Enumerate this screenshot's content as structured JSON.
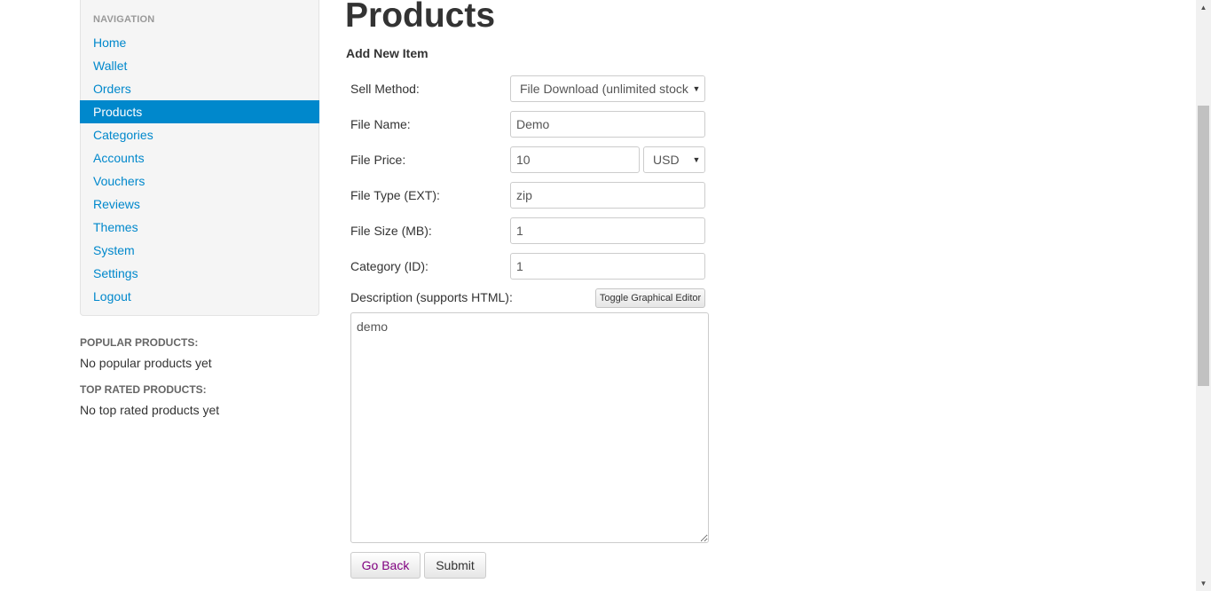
{
  "sidebar": {
    "nav_header": "NAVIGATION",
    "items": [
      {
        "label": "Home"
      },
      {
        "label": "Wallet"
      },
      {
        "label": "Orders"
      },
      {
        "label": "Products"
      },
      {
        "label": "Categories"
      },
      {
        "label": "Accounts"
      },
      {
        "label": "Vouchers"
      },
      {
        "label": "Reviews"
      },
      {
        "label": "Themes"
      },
      {
        "label": "System"
      },
      {
        "label": "Settings"
      },
      {
        "label": "Logout"
      }
    ],
    "active_item": "Products",
    "popular_heading": "POPULAR PRODUCTS:",
    "popular_text": "No popular products yet",
    "top_rated_heading": "TOP RATED PRODUCTS:",
    "top_rated_text": "No top rated products yet"
  },
  "main": {
    "title": "Products",
    "subheading": "Add New Item",
    "form": {
      "sell_method_label": "Sell Method:",
      "sell_method_value": "File Download (unlimited stock)",
      "file_name_label": "File Name:",
      "file_name_value": "Demo",
      "file_price_label": "File Price:",
      "file_price_value": "10",
      "currency_value": "USD",
      "file_type_label": "File Type (EXT):",
      "file_type_value": "zip",
      "file_size_label": "File Size (MB):",
      "file_size_value": "1",
      "category_label": "Category (ID):",
      "category_value": "1",
      "description_label": "Description (supports HTML):",
      "toggle_editor_label": "Toggle Graphical Editor",
      "description_value": "demo"
    },
    "buttons": {
      "back_label": "Go Back",
      "submit_label": "Submit"
    }
  },
  "colors": {
    "link": "#0088cc",
    "active_bg": "#0088cc",
    "go_back_text": "#800080"
  },
  "icons": {
    "select_caret": "▼",
    "scroll_up": "▲",
    "scroll_down": "▼"
  }
}
